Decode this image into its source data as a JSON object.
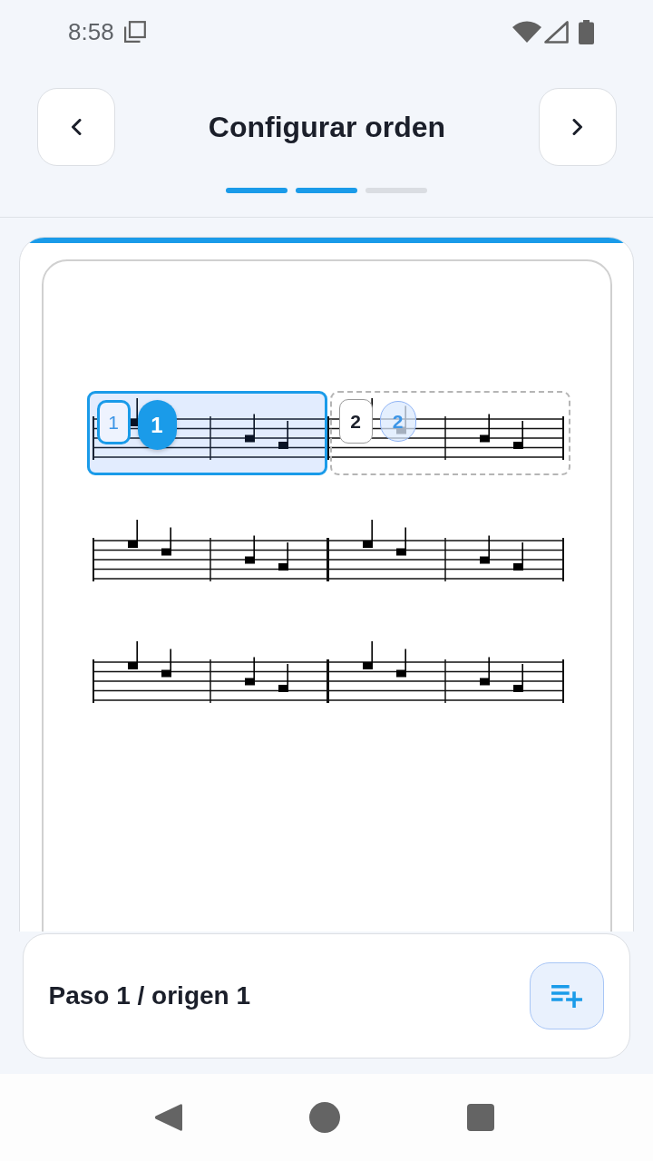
{
  "status_bar": {
    "time": "8:58"
  },
  "header": {
    "title": "Configurar orden",
    "steps": [
      {
        "done": true
      },
      {
        "done": true
      },
      {
        "done": false
      }
    ]
  },
  "score": {
    "segments": [
      {
        "slot": "1",
        "marker": "1",
        "selected": true
      },
      {
        "slot": "2",
        "marker": "2",
        "selected": false
      }
    ]
  },
  "footer": {
    "label": "Paso 1 / origen 1"
  }
}
